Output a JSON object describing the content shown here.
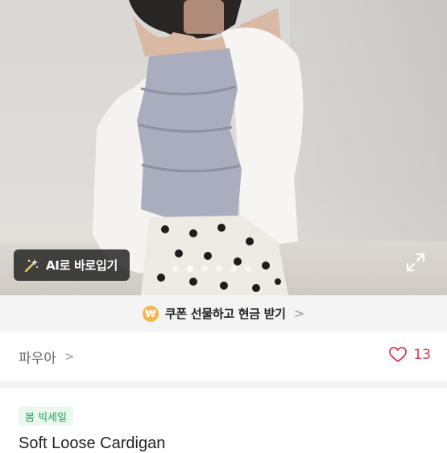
{
  "photo": {
    "alt": "product photo"
  },
  "ai_button": {
    "label": "AI로 바로입기",
    "icon": "magic-wand-icon"
  },
  "carousel": {
    "total": 6,
    "active_index": 1
  },
  "coupon": {
    "text": "쿠폰 선물하고 현금 받기",
    "coin_symbol": "₩",
    "chevron": ">"
  },
  "shop": {
    "name": "파우아",
    "chevron": ">"
  },
  "likes": {
    "count": "13",
    "icon": "heart-icon",
    "color": "#e0334f"
  },
  "badge": {
    "label": "봄 빅세일",
    "color": "#22a55a"
  },
  "product": {
    "title": "Soft Loose Cardigan"
  }
}
